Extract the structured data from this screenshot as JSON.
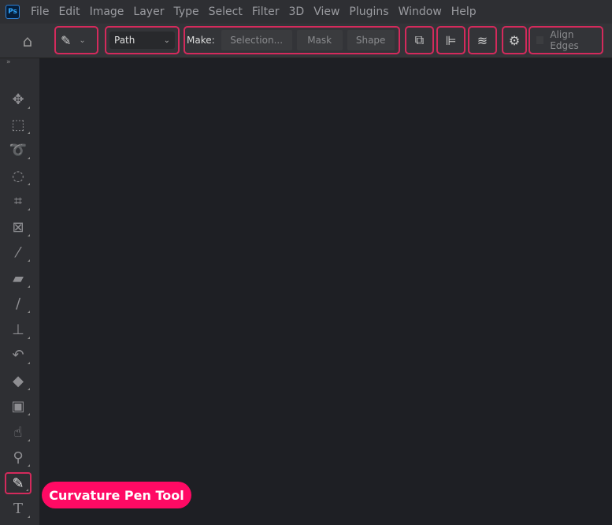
{
  "menubar": {
    "logo": "Ps",
    "items": [
      "File",
      "Edit",
      "Image",
      "Layer",
      "Type",
      "Select",
      "Filter",
      "3D",
      "View",
      "Plugins",
      "Window",
      "Help"
    ]
  },
  "options": {
    "mode": "Path",
    "make_label": "Make:",
    "selection": "Selection...",
    "mask": "Mask",
    "shape": "Shape",
    "align_edges": "Align Edges",
    "align_edges_checked": false
  },
  "tools": [
    "move-icon",
    "marquee-icon",
    "lasso-icon",
    "quick-selection-icon",
    "crop-icon",
    "frame-icon",
    "eyedropper-icon",
    "healing-brush-icon",
    "brush-icon",
    "clone-stamp-icon",
    "history-brush-icon",
    "eraser-icon",
    "gradient-icon",
    "smudge-icon",
    "dodge-icon",
    "curvature-pen-icon",
    "type-icon"
  ],
  "selected_tool": "curvature-pen-icon",
  "tooltip": "Curvature Pen Tool",
  "colors": {
    "highlight": "#d42a5c",
    "tooltip": "#ff0a64",
    "canvas": "#1e1f24"
  }
}
